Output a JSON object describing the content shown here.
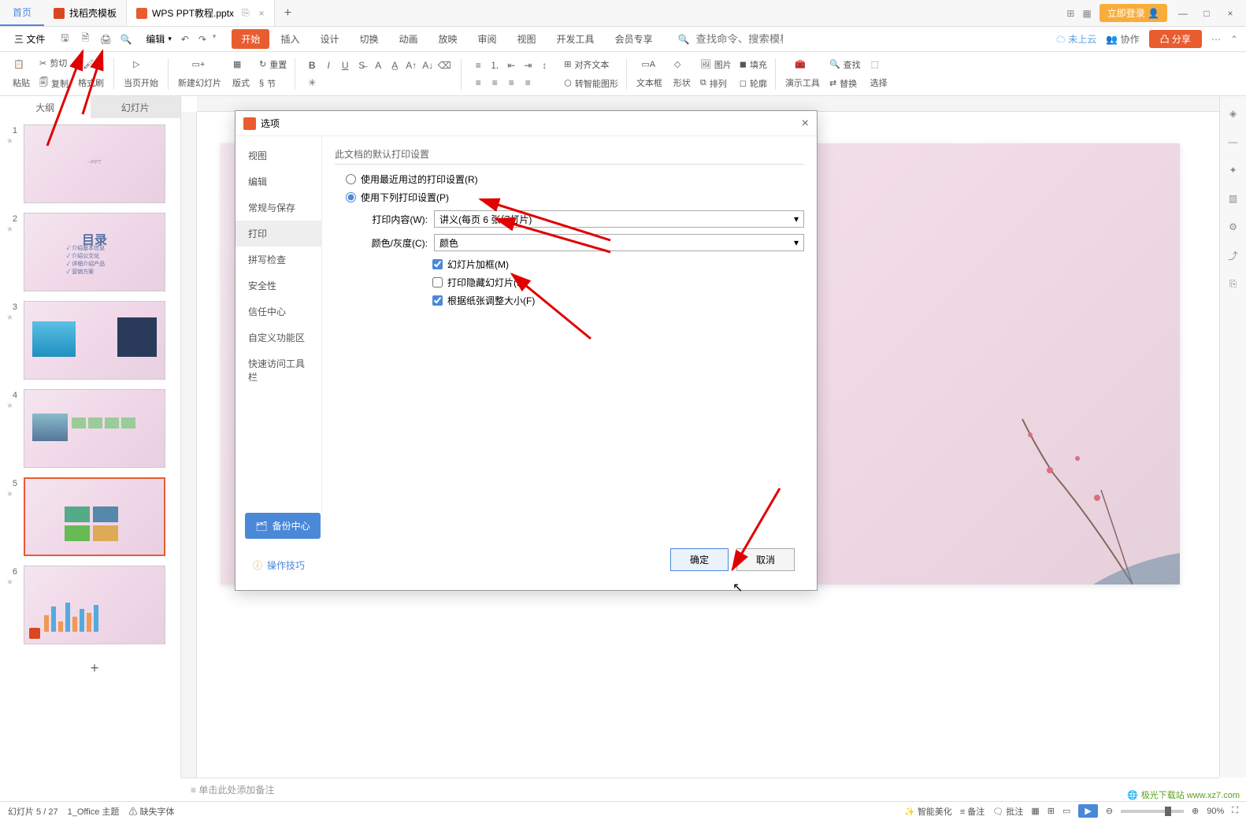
{
  "titlebar": {
    "home": "首页",
    "tab1": "找稻壳模板",
    "tab2": "WPS PPT教程.pptx",
    "add": "+",
    "login": "立即登录"
  },
  "menubar": {
    "file": "三 文件",
    "edit": "编辑",
    "tabs": [
      "开始",
      "插入",
      "设计",
      "切换",
      "动画",
      "放映",
      "审阅",
      "视图",
      "开发工具",
      "会员专享"
    ],
    "active_tab": "开始",
    "search_placeholder": "查找命令、搜索模板",
    "cloud": "未上云",
    "collab": "协作",
    "share": "分享"
  },
  "ribbon": {
    "paste": "粘贴",
    "cut": "剪切",
    "copy": "复制",
    "format_painter": "格式刷",
    "from_current": "当页开始",
    "new_slide": "新建幻灯片",
    "layout": "版式",
    "section": "节",
    "reset": "重置",
    "textbox": "文本框",
    "shapes": "形状",
    "picture": "图片",
    "arrange": "排列",
    "fill": "填充",
    "outline": "轮廓",
    "align_text": "对齐文本",
    "smart_graphic": "转智能图形",
    "tools": "演示工具",
    "find": "查找",
    "replace": "替换",
    "select": "选择"
  },
  "sidebar": {
    "outline": "大纲",
    "slides": "幻灯片",
    "thumb2_title": "目录",
    "thumb2_items": [
      "✓ 介绍基本信息",
      "✓ 介绍公文化",
      "✓ 详细介绍产品",
      "✓ 营销方案"
    ]
  },
  "notes_placeholder": "单击此处添加备注",
  "statusbar": {
    "slide": "幻灯片 5 / 27",
    "theme": "1_Office 主题",
    "missing_font": "缺失字体",
    "smart_beautify": "智能美化",
    "notes": "备注",
    "comments": "批注",
    "zoom": "90%"
  },
  "dialog": {
    "title": "选项",
    "nav": [
      "视图",
      "编辑",
      "常规与保存",
      "打印",
      "拼写检查",
      "安全性",
      "信任中心",
      "自定义功能区",
      "快速访问工具栏"
    ],
    "active_nav": "打印",
    "section": "此文档的默认打印设置",
    "radio1": "使用最近用过的打印设置(R)",
    "radio2": "使用下列打印设置(P)",
    "print_content_label": "打印内容(W):",
    "print_content_value": "讲义(每页 6 张幻灯片)",
    "color_label": "颜色/灰度(C):",
    "color_value": "颜色",
    "check_frame": "幻灯片加框(M)",
    "check_hidden": "打印隐藏幻灯片(H)",
    "check_fit": "根据纸张调整大小(F)",
    "backup": "备份中心",
    "tips": "操作技巧",
    "ok": "确定",
    "cancel": "取消"
  },
  "watermark": "极光下载站 www.xz7.com"
}
